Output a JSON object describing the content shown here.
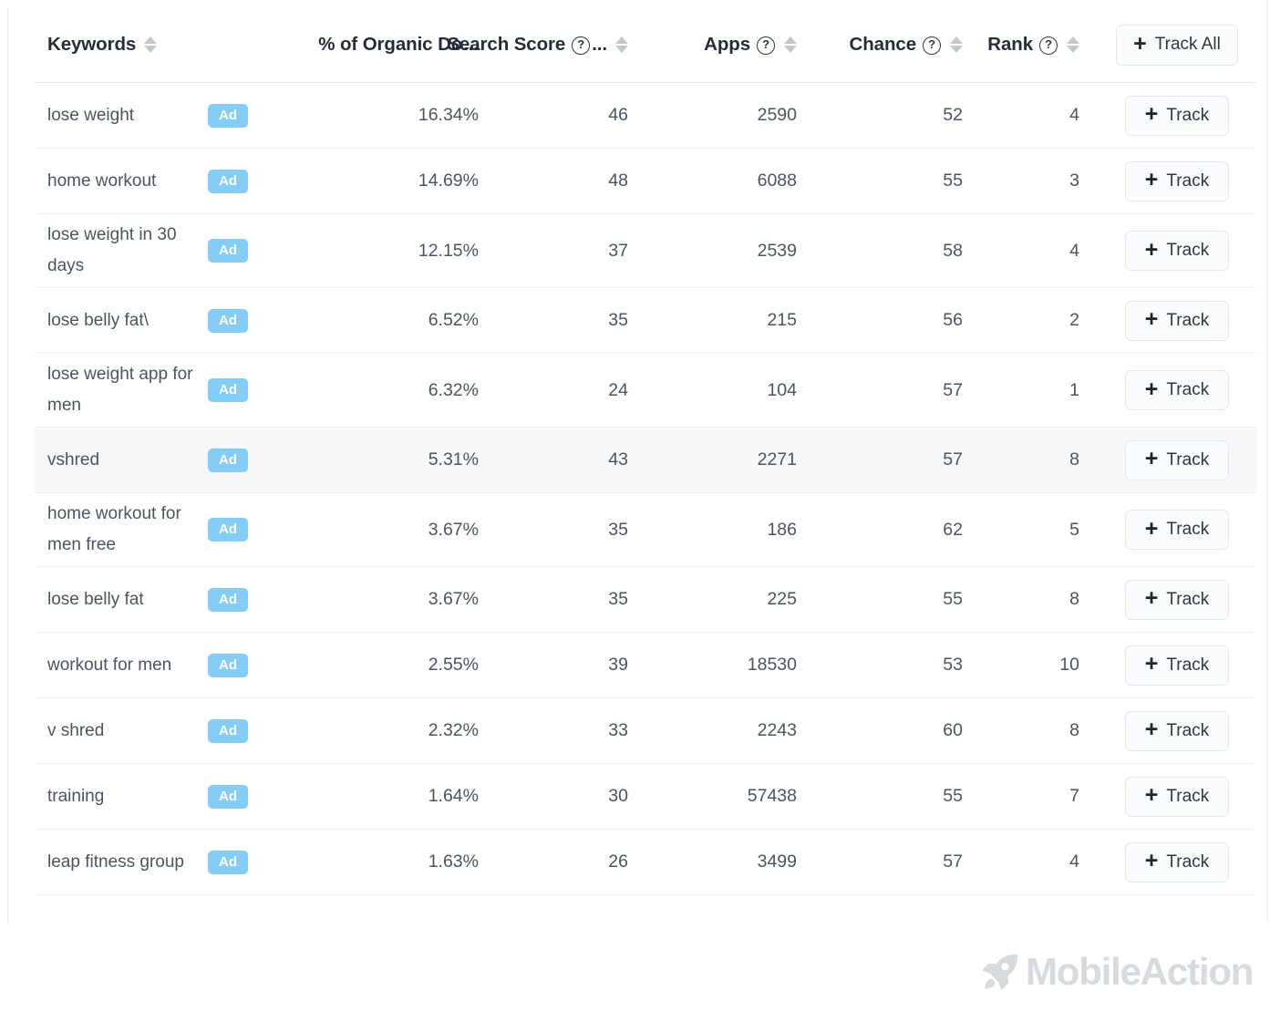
{
  "table": {
    "columns": [
      {
        "key": "keywords",
        "label": "Keywords",
        "has_help": false,
        "truncated": false,
        "sortable": true,
        "align": "left"
      },
      {
        "key": "ad",
        "label": "",
        "has_help": false,
        "truncated": false,
        "sortable": false,
        "align": "left"
      },
      {
        "key": "organic",
        "label": "% of Organic Do",
        "has_help": false,
        "truncated": true,
        "sortable": false,
        "align": "right"
      },
      {
        "key": "score",
        "label": "Search Score",
        "has_help": true,
        "truncated": true,
        "sortable": true,
        "align": "right"
      },
      {
        "key": "apps",
        "label": "Apps",
        "has_help": true,
        "truncated": false,
        "sortable": true,
        "align": "right"
      },
      {
        "key": "chance",
        "label": "Chance",
        "has_help": true,
        "truncated": false,
        "sortable": true,
        "align": "right"
      },
      {
        "key": "rank",
        "label": "Rank",
        "has_help": true,
        "truncated": false,
        "sortable": true,
        "align": "right"
      }
    ],
    "ellipsis": "...",
    "track_all_label": "Track All",
    "track_label": "Track",
    "plus_glyph": "+",
    "ad_badge_label": "Ad",
    "ad_badge_color": "#84cdf6",
    "highlight_color": "#f7f8fa",
    "rows": [
      {
        "keyword": "lose weight",
        "ad": "Ad",
        "organic": "16.34%",
        "score": "46",
        "apps": "2590",
        "chance": "52",
        "rank": "4",
        "track": "Track",
        "highlighted": false,
        "tall": false
      },
      {
        "keyword": "home workout",
        "ad": "Ad",
        "organic": "14.69%",
        "score": "48",
        "apps": "6088",
        "chance": "55",
        "rank": "3",
        "track": "Track",
        "highlighted": false,
        "tall": false
      },
      {
        "keyword": "lose weight in 30 days",
        "ad": "Ad",
        "organic": "12.15%",
        "score": "37",
        "apps": "2539",
        "chance": "58",
        "rank": "4",
        "track": "Track",
        "highlighted": false,
        "tall": true
      },
      {
        "keyword": "lose belly fat\\",
        "ad": "Ad",
        "organic": "6.52%",
        "score": "35",
        "apps": "215",
        "chance": "56",
        "rank": "2",
        "track": "Track",
        "highlighted": false,
        "tall": false
      },
      {
        "keyword": "lose weight app for men",
        "ad": "Ad",
        "organic": "6.32%",
        "score": "24",
        "apps": "104",
        "chance": "57",
        "rank": "1",
        "track": "Track",
        "highlighted": false,
        "tall": true
      },
      {
        "keyword": "vshred",
        "ad": "Ad",
        "organic": "5.31%",
        "score": "43",
        "apps": "2271",
        "chance": "57",
        "rank": "8",
        "track": "Track",
        "highlighted": true,
        "tall": false
      },
      {
        "keyword": "home workout for men free",
        "ad": "Ad",
        "organic": "3.67%",
        "score": "35",
        "apps": "186",
        "chance": "62",
        "rank": "5",
        "track": "Track",
        "highlighted": false,
        "tall": true
      },
      {
        "keyword": "lose belly fat",
        "ad": "Ad",
        "organic": "3.67%",
        "score": "35",
        "apps": "225",
        "chance": "55",
        "rank": "8",
        "track": "Track",
        "highlighted": false,
        "tall": false
      },
      {
        "keyword": "workout for men",
        "ad": "Ad",
        "organic": "2.55%",
        "score": "39",
        "apps": "18530",
        "chance": "53",
        "rank": "10",
        "track": "Track",
        "highlighted": false,
        "tall": false
      },
      {
        "keyword": "v shred",
        "ad": "Ad",
        "organic": "2.32%",
        "score": "33",
        "apps": "2243",
        "chance": "60",
        "rank": "8",
        "track": "Track",
        "highlighted": false,
        "tall": false
      },
      {
        "keyword": "training",
        "ad": "Ad",
        "organic": "1.64%",
        "score": "30",
        "apps": "57438",
        "chance": "55",
        "rank": "7",
        "track": "Track",
        "highlighted": false,
        "tall": false
      },
      {
        "keyword": "leap fitness group",
        "ad": "Ad",
        "organic": "1.63%",
        "score": "26",
        "apps": "3499",
        "chance": "57",
        "rank": "4",
        "track": "Track",
        "highlighted": false,
        "tall": false
      }
    ]
  },
  "footer": {
    "brand_name": "MobileAction",
    "brand_color": "#d7dade"
  }
}
